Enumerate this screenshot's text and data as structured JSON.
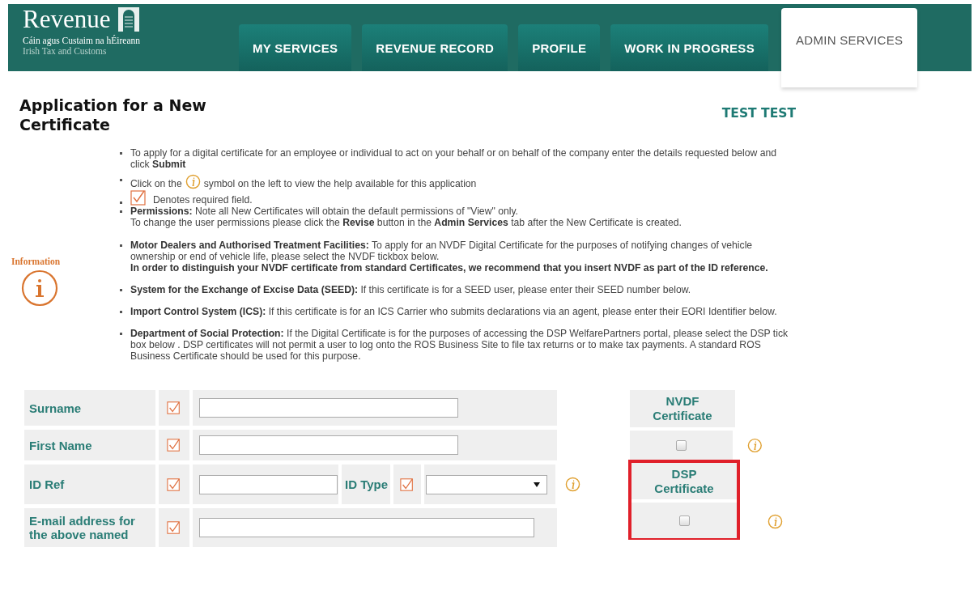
{
  "header": {
    "logo": {
      "name": "Revenue",
      "irish": "Cáin agus Custaim na hÉireann",
      "english": "Irish Tax and Customs"
    },
    "tabs": [
      {
        "label": "MY SERVICES",
        "selected": false
      },
      {
        "label": "REVENUE RECORD",
        "selected": false
      },
      {
        "label": "PROFILE",
        "selected": false
      },
      {
        "label": "WORK IN PROGRESS",
        "selected": false
      },
      {
        "label": "ADMIN SERVICES",
        "selected": true
      }
    ]
  },
  "title": "Application for a New Certificate",
  "user_name": "TEST TEST",
  "information_label": "Information",
  "bullets": [
    {
      "kind": "text",
      "lines": [
        "To apply for a digital certificate for an employee or individual to act on your behalf or on behalf of the company enter the details requested below and click **Submit**"
      ]
    },
    {
      "kind": "info_symbol",
      "before": "Click on the",
      "after": "symbol on the left to view the help available for this application"
    },
    {
      "kind": "required_symbol",
      "text": "Denotes required field."
    },
    {
      "kind": "text",
      "lines": [
        "**Permissions:** Note all New Certificates will obtain the default permissions of \"View\" only.",
        "To change the user permissions please click the **Revise** button in the **Admin Services** tab after the New Certificate is created."
      ]
    },
    {
      "kind": "text",
      "lines": [
        "**Motor Dealers and Authorised Treatment Facilities:** To apply for an NVDF Digital Certificate for the purposes of notifying changes of vehicle ownership or end of vehicle life, please select the NVDF tickbox below.",
        "**In order to distinguish your NVDF certificate from standard Certificates, we recommend that you insert NVDF as part of the ID reference.**"
      ]
    },
    {
      "kind": "text",
      "lines": [
        "**System for the Exchange of Excise Data (SEED):** If this certificate is for a SEED user, please enter their SEED number below."
      ]
    },
    {
      "kind": "text",
      "lines": [
        "**Import Control System (ICS):** If this certificate is for an ICS Carrier who submits declarations via an agent, please enter their EORI Identifier below."
      ]
    },
    {
      "kind": "text",
      "lines": [
        "**Department of Social Protection:** If the Digital Certificate is for the purposes of accessing the DSP WelfarePartners portal, please select the DSP tick box below . DSP certificates will not permit a user to log onto the ROS Business Site to file tax returns or to make tax payments. A standard ROS Business Certificate should be used for this purpose."
      ]
    }
  ],
  "form_rows": [
    {
      "kind": "text",
      "label": "Surname",
      "required": true
    },
    {
      "kind": "text",
      "label": "First Name",
      "required": true
    },
    {
      "kind": "id",
      "label": "ID Ref",
      "required": true,
      "type_label": "ID Type",
      "type_required": true,
      "help": true
    },
    {
      "kind": "text",
      "label": "E-mail address for the above named",
      "required": true
    }
  ],
  "certificates": [
    {
      "label": "NVDF Certificate",
      "checked": false,
      "highlighted": false
    },
    {
      "label": "DSP Certificate",
      "checked": false,
      "highlighted": true
    }
  ]
}
